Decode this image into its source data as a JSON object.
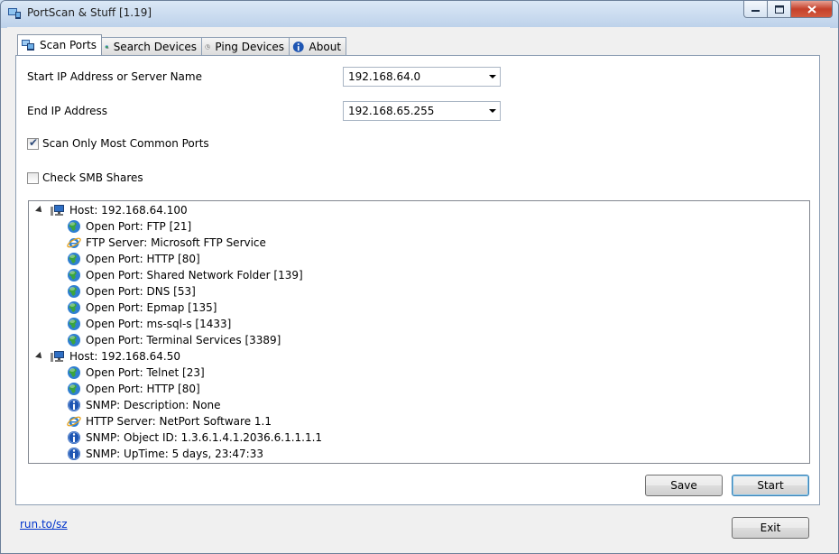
{
  "window": {
    "title": "PortScan & Stuff [1.19]"
  },
  "tabs": [
    {
      "label": "Scan Ports",
      "icon": "scan-ports-icon"
    },
    {
      "label": "Search Devices",
      "icon": "search-devices-icon"
    },
    {
      "label": "Ping Devices",
      "icon": "ping-devices-icon"
    },
    {
      "label": "About",
      "icon": "info-icon"
    }
  ],
  "form": {
    "start_ip_label": "Start IP Address or Server Name",
    "start_ip_value": "192.168.64.0",
    "end_ip_label": "End IP Address",
    "end_ip_value": "192.168.65.255",
    "common_ports_label": "Scan Only Most Common Ports",
    "common_ports_checked": true,
    "smb_label": "Check SMB Shares",
    "smb_checked": false
  },
  "results": [
    {
      "host": "Host: 192.168.64.100",
      "items": [
        {
          "icon": "globe-icon",
          "text": "Open Port: FTP [21]"
        },
        {
          "icon": "ie-icon",
          "text": "FTP Server: Microsoft FTP Service"
        },
        {
          "icon": "globe-icon",
          "text": "Open Port: HTTP [80]"
        },
        {
          "icon": "globe-icon",
          "text": "Open Port: Shared Network Folder [139]"
        },
        {
          "icon": "globe-icon",
          "text": "Open Port: DNS [53]"
        },
        {
          "icon": "globe-icon",
          "text": "Open Port: Epmap [135]"
        },
        {
          "icon": "globe-icon",
          "text": "Open Port: ms-sql-s [1433]"
        },
        {
          "icon": "globe-icon",
          "text": "Open Port: Terminal Services [3389]"
        }
      ]
    },
    {
      "host": "Host: 192.168.64.50",
      "items": [
        {
          "icon": "globe-icon",
          "text": "Open Port: Telnet [23]"
        },
        {
          "icon": "globe-icon",
          "text": "Open Port: HTTP [80]"
        },
        {
          "icon": "info-icon",
          "text": "SNMP: Description: None"
        },
        {
          "icon": "ie-icon",
          "text": "HTTP Server: NetPort Software 1.1"
        },
        {
          "icon": "info-icon",
          "text": "SNMP: Object ID: 1.3.6.1.4.1.2036.6.1.1.1.1"
        },
        {
          "icon": "info-icon",
          "text": "SNMP: UpTime: 5 days, 23:47:33"
        }
      ]
    }
  ],
  "buttons": {
    "save": "Save",
    "start": "Start",
    "exit": "Exit"
  },
  "footer": {
    "link": "run.to/sz"
  }
}
